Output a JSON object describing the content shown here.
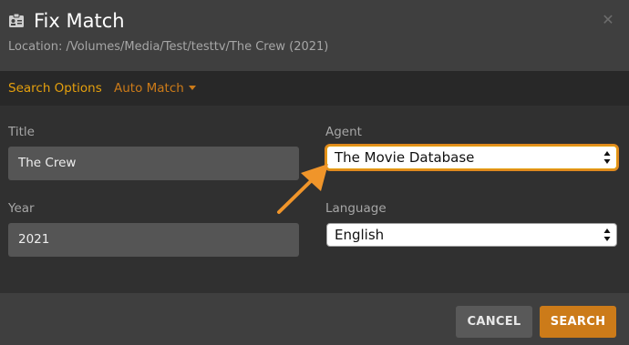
{
  "dialog": {
    "title": "Fix Match",
    "location": "Location: /Volumes/Media/Test/testtv/The Crew (2021)",
    "close_icon": "close-icon"
  },
  "tabs": {
    "search_options": "Search Options",
    "auto_match": "Auto Match"
  },
  "form": {
    "title_label": "Title",
    "title_value": "The Crew",
    "year_label": "Year",
    "year_value": "2021",
    "agent_label": "Agent",
    "agent_value": "The Movie Database",
    "language_label": "Language",
    "language_value": "English"
  },
  "footer": {
    "cancel_label": "CANCEL",
    "search_label": "SEARCH"
  },
  "colors": {
    "accent": "#e5a00d",
    "search_button": "#cc7b19",
    "annotation_arrow": "#f0952a"
  }
}
